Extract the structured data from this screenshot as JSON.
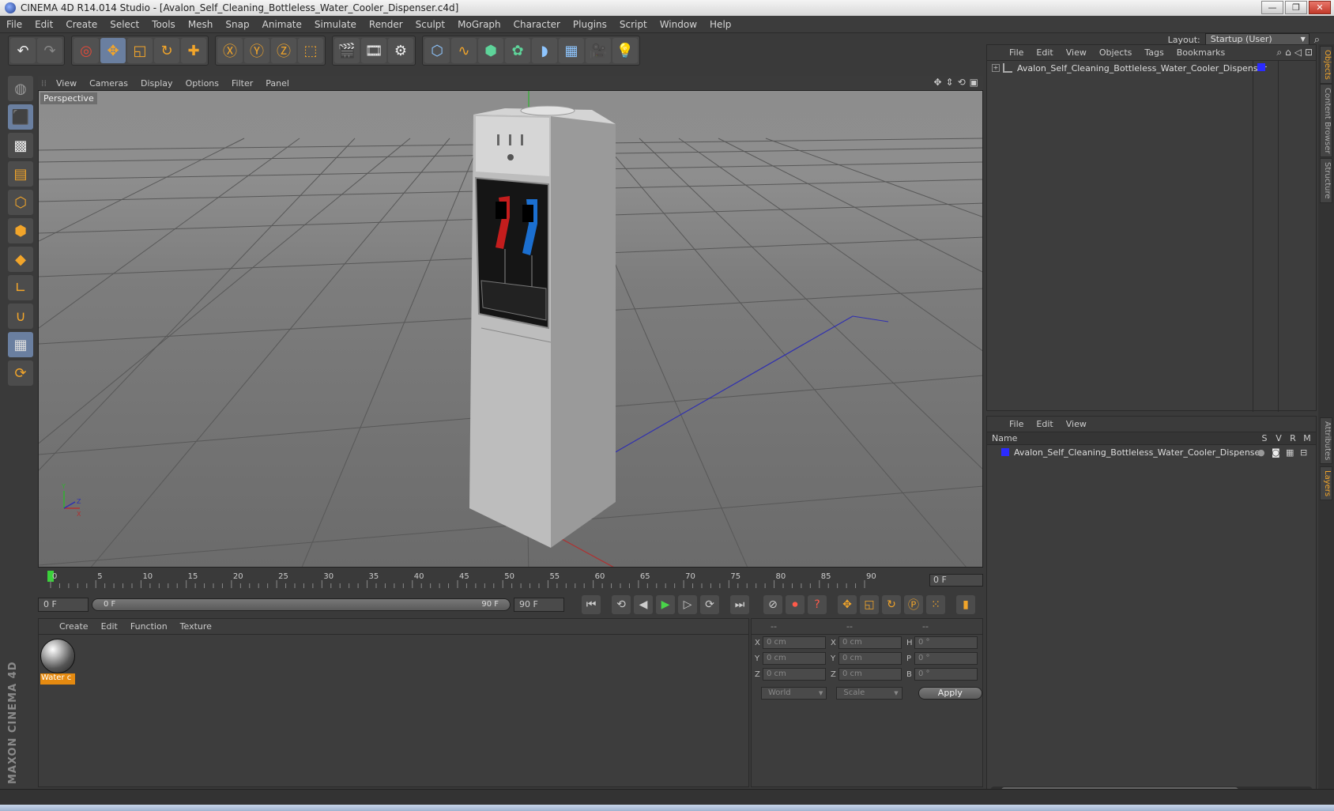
{
  "window": {
    "title": "CINEMA 4D R14.014 Studio - [Avalon_Self_Cleaning_Bottleless_Water_Cooler_Dispenser.c4d]",
    "min": "—",
    "max": "❐",
    "close": "✕"
  },
  "menu": [
    "File",
    "Edit",
    "Create",
    "Select",
    "Tools",
    "Mesh",
    "Snap",
    "Animate",
    "Simulate",
    "Render",
    "Sculpt",
    "MoGraph",
    "Character",
    "Plugins",
    "Script",
    "Window",
    "Help"
  ],
  "layout": {
    "label": "Layout:",
    "value": "Startup (User)"
  },
  "viewport": {
    "menu": [
      "View",
      "Cameras",
      "Display",
      "Options",
      "Filter",
      "Panel"
    ],
    "label": "Perspective",
    "axis_x": "X",
    "axis_y": "Y",
    "axis_z": "Z"
  },
  "timeline": {
    "ticks": [
      "0",
      "5",
      "10",
      "15",
      "20",
      "25",
      "30",
      "35",
      "40",
      "45",
      "50",
      "55",
      "60",
      "65",
      "70",
      "75",
      "80",
      "85",
      "90"
    ],
    "current": "0 F",
    "start": "0 F",
    "slider_start": "0 F",
    "slider_end": "90 F",
    "end": "90 F"
  },
  "material_manager": {
    "menu": [
      "Create",
      "Edit",
      "Function",
      "Texture"
    ],
    "material_name": "Water c"
  },
  "coordinates": {
    "headers": [
      "--",
      "--",
      "--"
    ],
    "rows": [
      {
        "l1": "X",
        "v1": "0 cm",
        "l2": "X",
        "v2": "0 cm",
        "l3": "H",
        "v3": "0 °"
      },
      {
        "l1": "Y",
        "v1": "0 cm",
        "l2": "Y",
        "v2": "0 cm",
        "l3": "P",
        "v3": "0 °"
      },
      {
        "l1": "Z",
        "v1": "0 cm",
        "l2": "Z",
        "v2": "0 cm",
        "l3": "B",
        "v3": "0 °"
      }
    ],
    "mode": "World",
    "scale": "Scale",
    "apply": "Apply"
  },
  "object_manager": {
    "menu": [
      "File",
      "Edit",
      "View",
      "Objects",
      "Tags",
      "Bookmarks"
    ],
    "object_name": "Avalon_Self_Cleaning_Bottleless_Water_Cooler_Dispenser",
    "tag_color": "#2b2bff"
  },
  "layer_manager": {
    "menu": [
      "File",
      "Edit",
      "View"
    ],
    "columns": {
      "name": "Name",
      "s": "S",
      "v": "V",
      "r": "R",
      "m": "M"
    },
    "layer_name": "Avalon_Self_Cleaning_Bottleless_Water_Cooler_Dispenser"
  },
  "side_tabs": [
    "Objects",
    "Content Browser",
    "Structure",
    "Attributes",
    "Layers"
  ],
  "brand": "MAXON CINEMA 4D"
}
